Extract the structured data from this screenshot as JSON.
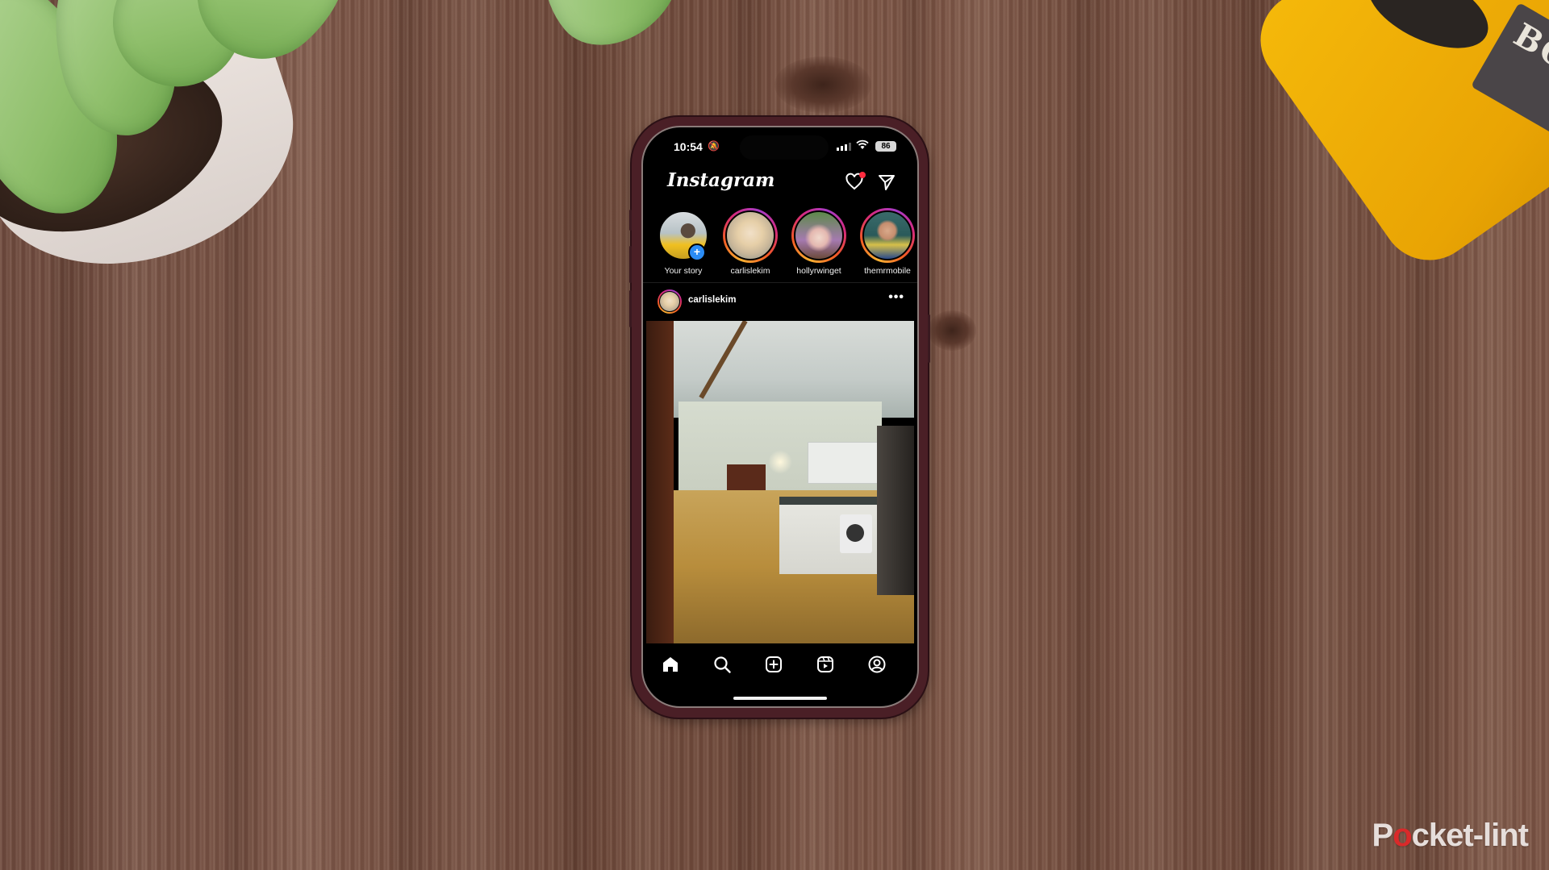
{
  "scene": {
    "watermark": {
      "prefix": "P",
      "o": "o",
      "suffix": "cket-lint"
    },
    "speaker_brand": "BOS"
  },
  "status_bar": {
    "time": "10:54",
    "bell_icon": "bell-slash-icon",
    "battery_percent": "86"
  },
  "header": {
    "app_title": "Instagram",
    "notifications_badge": true
  },
  "stories": [
    {
      "label": "Your story",
      "own": true
    },
    {
      "label": "carlislekim",
      "own": false
    },
    {
      "label": "hollyrwinget",
      "own": false
    },
    {
      "label": "themrmobile",
      "own": false
    }
  ],
  "post": {
    "username": "carlislekim",
    "more_label": "•••",
    "image_subject": "kitchen interior"
  },
  "tabbar": {
    "items": [
      {
        "name": "home",
        "icon": "home-icon",
        "active": true
      },
      {
        "name": "search",
        "icon": "search-icon",
        "active": false
      },
      {
        "name": "create",
        "icon": "plus-square-icon",
        "active": false
      },
      {
        "name": "reels",
        "icon": "reels-icon",
        "active": false
      },
      {
        "name": "profile",
        "icon": "profile-icon",
        "active": false
      }
    ]
  },
  "colors": {
    "story_ring": [
      "#f9b233",
      "#f15a24",
      "#d62a7c",
      "#a53cc8"
    ],
    "notification_dot": "#ff2b3f",
    "add_story_badge": "#2b8cf5",
    "phone_case": "#4a1f26",
    "watermark_accent": "#d92a2a"
  }
}
